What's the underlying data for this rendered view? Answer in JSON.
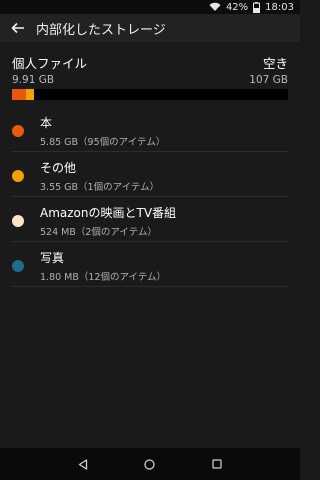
{
  "status_bar": {
    "battery": "42%",
    "time": "18:03",
    "icons": [
      "wifi-icon",
      "battery-icon"
    ]
  },
  "header": {
    "title": "内部化したストレージ",
    "back_icon": "back-arrow-icon"
  },
  "summary": {
    "personal_label": "個人ファイル",
    "personal_value": "9.91 GB",
    "free_label": "空き",
    "free_value": "107 GB"
  },
  "storage_bar": {
    "total_used_fraction": 0.085,
    "segments": [
      {
        "name": "本",
        "color": "#e8590c",
        "fraction": 0.05
      },
      {
        "name": "その他",
        "color": "#f6a100",
        "fraction": 0.03
      }
    ]
  },
  "items": [
    {
      "title": "本",
      "subtitle": "5.85 GB（95個のアイテム）",
      "color": "#e8590c"
    },
    {
      "title": "その他",
      "subtitle": "3.55 GB（1個のアイテム）",
      "color": "#f6a100"
    },
    {
      "title": "Amazonの映画とTV番組",
      "subtitle": "524 MB（2個のアイテム）",
      "color": "#fbe3c4"
    },
    {
      "title": "写真",
      "subtitle": "1.80 MB（12個のアイテム）",
      "color": "#1f6b8e"
    }
  ],
  "nav": {
    "icons": [
      "back-triangle-icon",
      "home-circle-icon",
      "recents-square-icon"
    ]
  }
}
